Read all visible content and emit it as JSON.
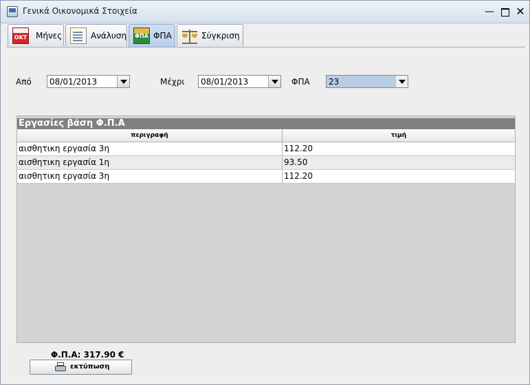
{
  "window": {
    "title": "Γενικά Οικονομικά Στοιχεία",
    "minimize_label": "—",
    "maximize_label": "",
    "close_label": "✕"
  },
  "tabs": [
    {
      "label": "Μήνες",
      "icon": "calendar-icon",
      "icon_text": "OKT",
      "active": false
    },
    {
      "label": "Ανάλυση",
      "icon": "document-icon",
      "active": false
    },
    {
      "label": "ΦΠΑ",
      "icon": "vat-icon",
      "icon_text": "ΦΠΑ",
      "active": true
    },
    {
      "label": "Σύγκριση",
      "icon": "scale-icon",
      "active": false
    }
  ],
  "filters": {
    "from_label": "Από",
    "from_value": "08/01/2013",
    "to_label": "Μέχρι",
    "to_value": "08/01/2013",
    "vat_label": "ΦΠΑ",
    "vat_value": "23"
  },
  "table": {
    "title": "Εργασίες βάση Φ.Π.Α",
    "columns": [
      "περιγραφή",
      "τιμή"
    ],
    "rows": [
      [
        "αισθητικη εργασία 3η",
        "112.20"
      ],
      [
        "αισθητικη εργασία 1η",
        "93.50"
      ],
      [
        "αισθητικη εργασία 3η",
        "112.20"
      ]
    ]
  },
  "summary": {
    "total_label": "Φ.Π.Α: 317.90 €"
  },
  "actions": {
    "print_label": "εκτύπωση"
  },
  "colors": {
    "active_tab": "#b8cde8",
    "table_header_bar": "#808080",
    "vat_combo": "#b8cce4"
  }
}
